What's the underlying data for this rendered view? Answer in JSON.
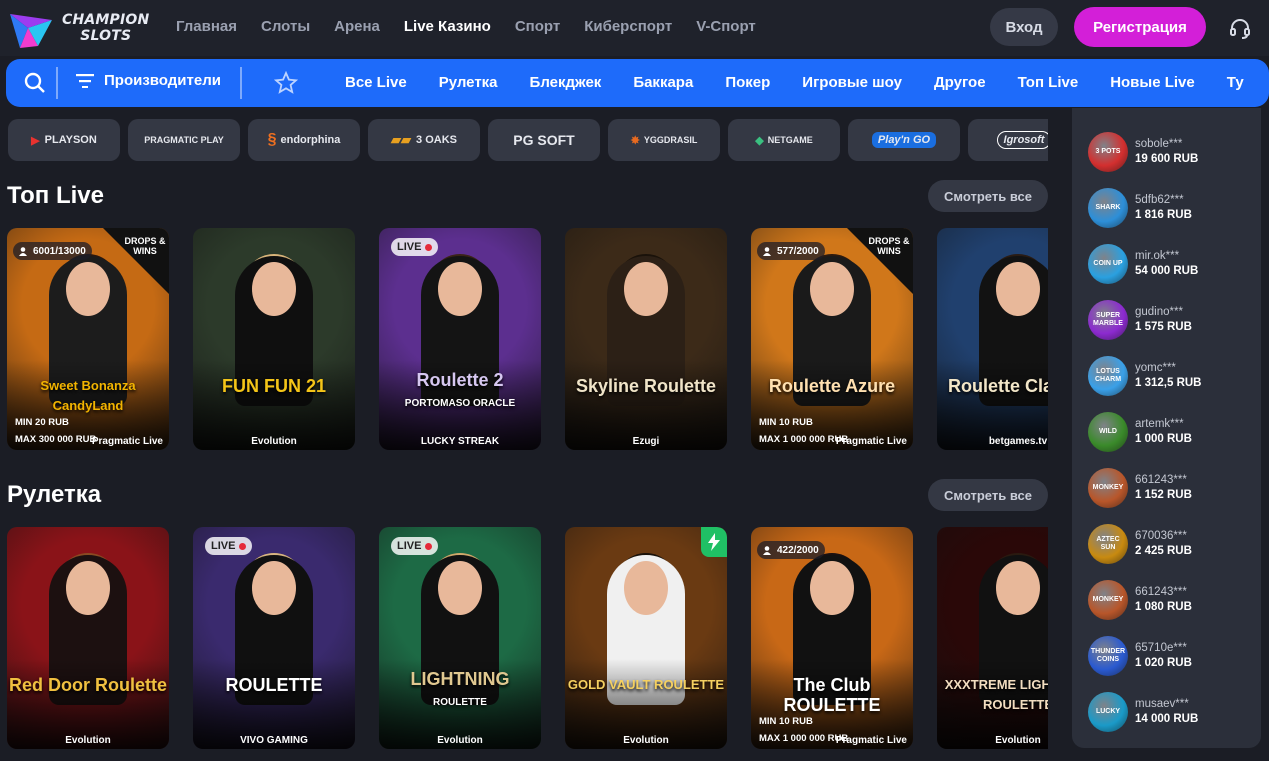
{
  "brand": {
    "line1": "CHAMPION",
    "line2": "SLOTS"
  },
  "nav": [
    "Главная",
    "Слоты",
    "Арена",
    "Live Казино",
    "Спорт",
    "Киберспорт",
    "V-Спорт"
  ],
  "nav_active": "Live Казино",
  "auth": {
    "login": "Вход",
    "register": "Регистрация"
  },
  "category_bar": {
    "providers_label": "Производители",
    "items": [
      "Все Live",
      "Рулетка",
      "Блекджек",
      "Баккара",
      "Покер",
      "Игровые шоу",
      "Другое",
      "Топ Live",
      "Новые Live",
      "Ту"
    ]
  },
  "providers": [
    "PLAYSON",
    "PRAGMATIC PLAY",
    "endorphina",
    "3 OAKS",
    "PG SOFT",
    "YGGDRASIL",
    "NETGAME",
    "Play'n GO",
    "Igrosoft"
  ],
  "sections": [
    {
      "title": "Топ Live",
      "see_all": "Смотреть все",
      "cards": [
        {
          "title": "Sweet Bonanza CandyLand",
          "maker": "Pragmatic Live",
          "count": "6001/13000",
          "drops": "DROPS & WINS",
          "min": "MIN 20 RUB",
          "max": "MAX 300 000 RUB",
          "bg": "#c56a14",
          "hair": "#2a1810",
          "body": "#1c1c1c",
          "title_color": "#f2b400"
        },
        {
          "title": "FUN FUN 21",
          "maker": "Evolution",
          "bg": "#2c3a2a",
          "hair": "#d9b47a",
          "body": "#0f0f0f",
          "title_color": "#f4c518"
        },
        {
          "title": "Roulette 2",
          "subtitle": "PORTOMASO ORACLE",
          "maker": "LUCKY STREAK",
          "live": "LIVE",
          "bg": "#5c2f8f",
          "hair": "#3b2418",
          "body": "#141414",
          "title_color": "#d6c7f0"
        },
        {
          "title": "Skyline Roulette",
          "maker": "Ezugi",
          "bg": "#3c2a18",
          "hair": "#1a120a",
          "body": "#2c2016",
          "title_color": "#f0e4c8"
        },
        {
          "title": "Roulette Azure",
          "maker": "Pragmatic Live",
          "count": "577/2000",
          "drops": "DROPS & WINS",
          "min": "MIN 10 RUB",
          "max": "MAX 1 000 000 RUB",
          "bg": "#d0771a",
          "hair": "#2b1a10",
          "body": "#1a1a1a",
          "title_color": "#ffe0b0"
        },
        {
          "title": "Roulette Classic",
          "maker": "betgames.tv",
          "bg": "#20406e",
          "hair": "#2a1c14",
          "body": "#121212",
          "title_color": "#f2e6c8"
        }
      ]
    },
    {
      "title": "Рулетка",
      "see_all": "Смотреть все",
      "cards": [
        {
          "title": "Red Door Roulette",
          "maker": "Evolution",
          "bg": "#8a1318",
          "hair": "#8a4a22",
          "body": "#1c1010",
          "title_color": "#f0c040"
        },
        {
          "title": "ROULETTE",
          "maker": "VIVO GAMING",
          "live": "LIVE",
          "bg": "#3a2a6e",
          "hair": "#d8b580",
          "body": "#101010",
          "title_color": "#ffffff"
        },
        {
          "title": "LIGHTNING",
          "subtitle": "ROULETTE",
          "maker": "Evolution",
          "live": "LIVE",
          "bg": "#1d6a45",
          "hair": "#d0a86a",
          "body": "#111",
          "title_color": "#e0c890"
        },
        {
          "title": "GOLD VAULT ROULETTE",
          "maker": "Evolution",
          "bolt": true,
          "bg": "#6a3a12",
          "hair": "#1a120a",
          "body": "#f0f0f0",
          "title_color": "#f5d060"
        },
        {
          "title": "The Club ROULETTE",
          "maker": "Pragmatic Live",
          "count": "422/2000",
          "min": "MIN 10 RUB",
          "max": "MAX 1 000 000 RUB",
          "bg": "#c86816",
          "hair": "#1a1010",
          "body": "#111",
          "title_color": "#ffffff"
        },
        {
          "title": "XXXTREME LIGHTNING ROULETTE",
          "maker": "Evolution",
          "bg": "#2a0808",
          "hair": "#2a1a10",
          "body": "#111",
          "title_color": "#f2ddc0"
        }
      ]
    }
  ],
  "winners": [
    {
      "user": "sobole***",
      "amount": "19 600 RUB",
      "game": "3 POTS",
      "color": "#d32f2f"
    },
    {
      "user": "5dfb62***",
      "amount": "1 816 RUB",
      "game": "SHARK",
      "color": "#2d8fd8"
    },
    {
      "user": "mir.ok***",
      "amount": "54 000 RUB",
      "game": "COIN UP",
      "color": "#2aa0e0"
    },
    {
      "user": "gudino***",
      "amount": "1 575 RUB",
      "game": "SUPER MARBLE",
      "color": "#8c2ad0"
    },
    {
      "user": "yomc***",
      "amount": "1 312,5 RUB",
      "game": "LOTUS CHARM",
      "color": "#3aa0e8"
    },
    {
      "user": "artemk***",
      "amount": "1 000 RUB",
      "game": "WILD",
      "color": "#3a8a2a"
    },
    {
      "user": "661243***",
      "amount": "1 152 RUB",
      "game": "MONKEY",
      "color": "#b8562a"
    },
    {
      "user": "670036***",
      "amount": "2 425 RUB",
      "game": "AZTEC SUN",
      "color": "#c88a10"
    },
    {
      "user": "661243***",
      "amount": "1 080 RUB",
      "game": "MONKEY",
      "color": "#b8562a"
    },
    {
      "user": "65710e***",
      "amount": "1 020 RUB",
      "game": "THUNDER COINS",
      "color": "#2a5ad0"
    },
    {
      "user": "musaev***",
      "amount": "14 000 RUB",
      "game": "LUCKY",
      "color": "#1a9ac8"
    }
  ]
}
